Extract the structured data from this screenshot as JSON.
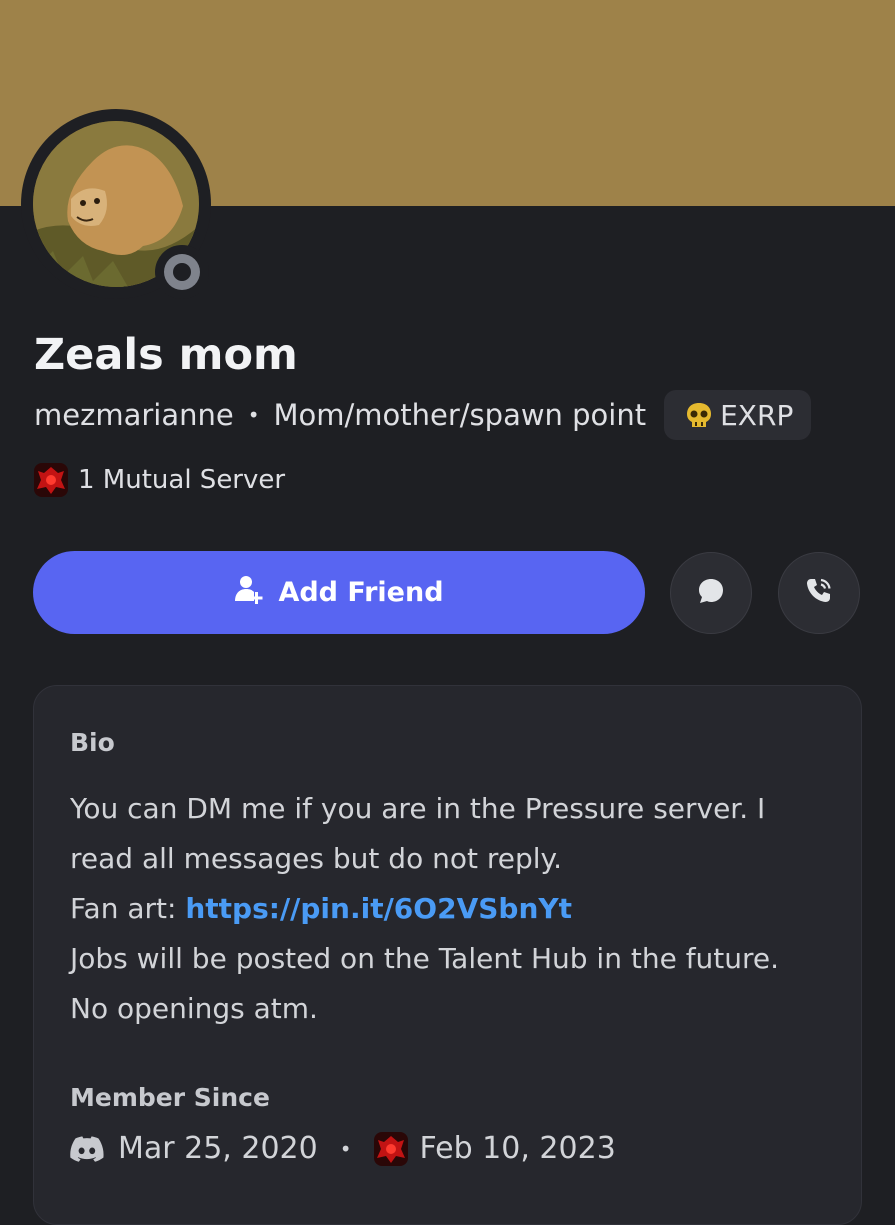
{
  "profile": {
    "display_name": "Zeals mom",
    "username": "mezmarianne",
    "pronouns": "Mom/mother/spawn point",
    "server_tag": "EXRP",
    "mutual_servers": "1 Mutual Server",
    "status": "offline"
  },
  "colors": {
    "banner": "#9e8249",
    "accent": "#5865f2",
    "link": "#4a9bf5"
  },
  "actions": {
    "add_friend_label": "Add Friend",
    "message_icon": "chat-bubble-icon",
    "call_icon": "phone-icon"
  },
  "bio": {
    "title": "Bio",
    "line1": "You can DM me if you are in the Pressure server. I",
    "line2": "read all messages but do not reply.",
    "fan_art_label": "Fan art: ",
    "fan_art_link": "https://pin.it/6O2VSbnYt",
    "line4": "Jobs will be posted on the Talent Hub in the future.",
    "line5": "No openings atm."
  },
  "member_since": {
    "title": "Member Since",
    "discord_date": "Mar 25, 2020",
    "server_date": "Feb 10, 2023"
  }
}
